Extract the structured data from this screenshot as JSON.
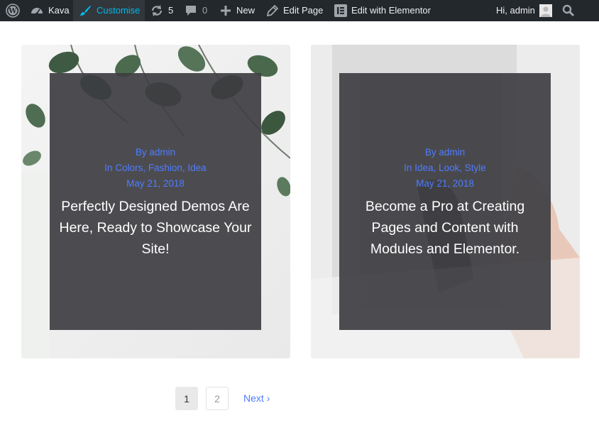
{
  "adminbar": {
    "wp_logo_icon": "wordpress-logo-icon",
    "site_name": "Kava",
    "customise": "Customise",
    "updates_count": "5",
    "comments_count": "0",
    "new_label": "New",
    "edit_page": "Edit Page",
    "edit_elementor": "Edit with Elementor",
    "greeting": "Hi, admin",
    "search_icon": "search-icon"
  },
  "posts": [
    {
      "author": "By admin",
      "categories_prefix": "In",
      "categories": [
        "Colors",
        "Fashion",
        "Idea"
      ],
      "date": "May 21, 2018",
      "title": "Perfectly Designed Demos Are Here, Ready to Showcase Your Site!"
    },
    {
      "author": "By admin",
      "categories_prefix": "In",
      "categories": [
        "Idea",
        "Look",
        "Style"
      ],
      "date": "May 21, 2018",
      "title": "Become a Pro at Creating Pages and Content with Modules and Elementor."
    }
  ],
  "pagination": {
    "page1": "1",
    "page2": "2",
    "next": "Next ›"
  },
  "colors": {
    "adminbar_bg": "#23282d",
    "accent": "#00b9eb",
    "meta_link": "#4f7cff",
    "overlay": "#3e3e42"
  }
}
